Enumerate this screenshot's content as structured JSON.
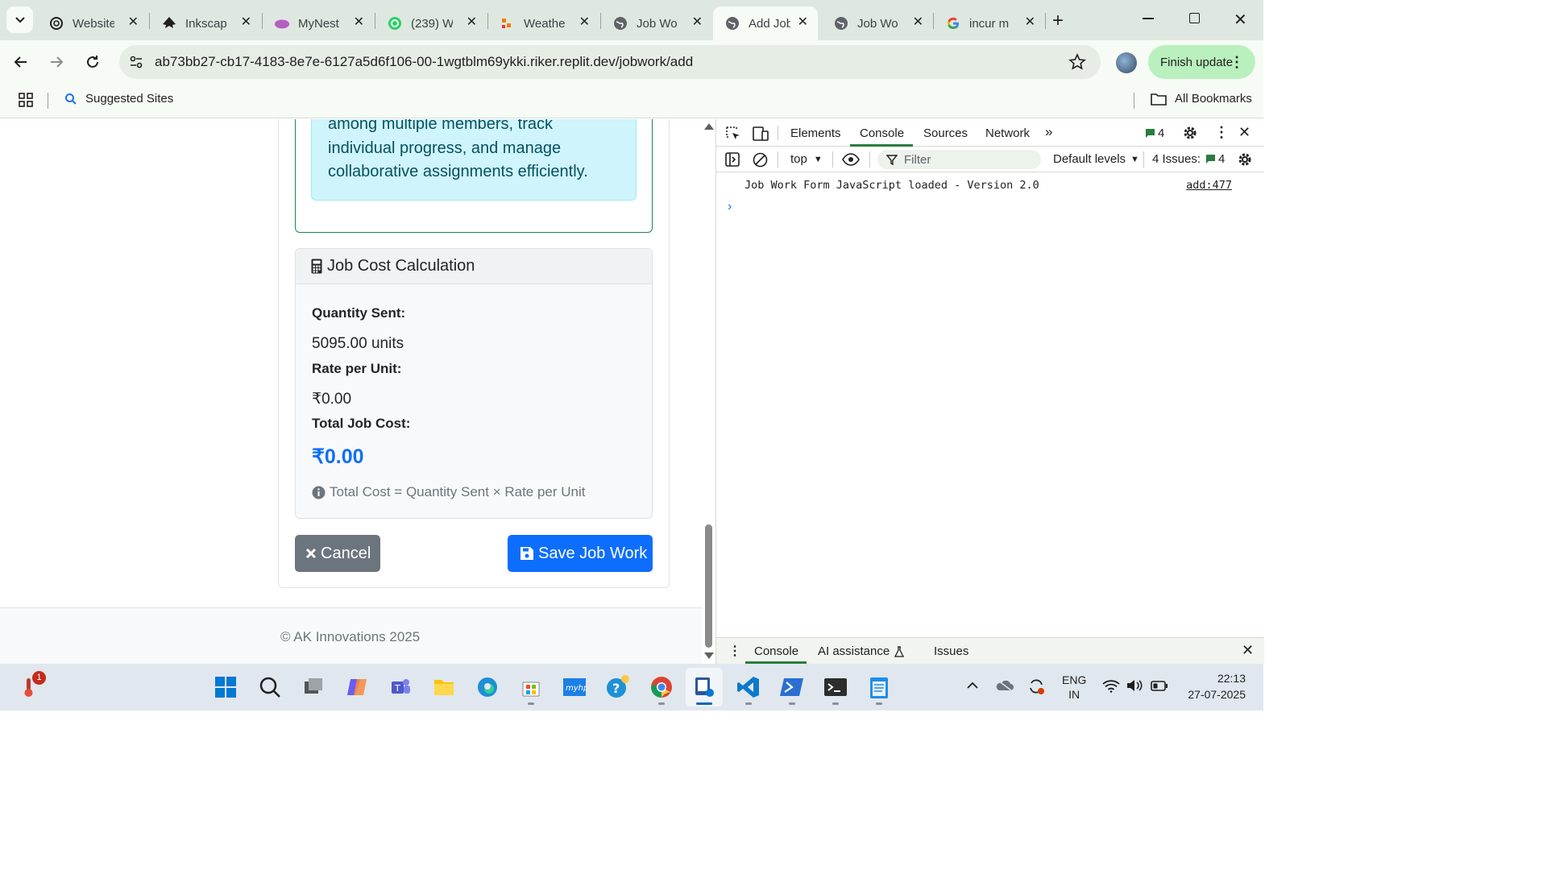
{
  "browser": {
    "tabs": [
      {
        "title": "Website",
        "icon": "openai-icon"
      },
      {
        "title": "Inkscape",
        "icon": "inkscape-icon"
      },
      {
        "title": "MyNest",
        "icon": "cloud-icon"
      },
      {
        "title": "(239) W",
        "icon": "whatsapp-icon"
      },
      {
        "title": "Weather",
        "icon": "weather-icon"
      },
      {
        "title": "Job Wo",
        "icon": "globe-icon"
      },
      {
        "title": "Add Job",
        "icon": "globe-icon",
        "active": true
      },
      {
        "title": "Job Wo",
        "icon": "globe-icon"
      },
      {
        "title": "incur m",
        "icon": "google-icon"
      }
    ],
    "url": "ab73bb27-cb17-4183-8e7e-6127a5d6f106-00-1wgtblm69ykki.riker.replit.dev/jobwork/add",
    "finish_update_label": "Finish update",
    "bookmarks": {
      "suggested": "Suggested Sites",
      "all": "All Bookmarks"
    }
  },
  "page": {
    "alert_lines": [
      "among multiple members, track",
      "individual progress, and manage",
      "collaborative assignments efficiently."
    ],
    "cost": {
      "title": "Job Cost Calculation",
      "quantity_label": "Quantity Sent:",
      "quantity_value": "5095.00 units",
      "rate_label": "Rate per Unit:",
      "rate_value": "₹0.00",
      "total_label": "Total Job Cost:",
      "total_value": "₹0.00",
      "formula": "Total Cost = Quantity Sent × Rate per Unit"
    },
    "cancel_label": "Cancel",
    "save_label": "Save Job Work",
    "footer": "© AK Innovations 2025"
  },
  "devtools": {
    "tabs": [
      "Elements",
      "Console",
      "Sources",
      "Network"
    ],
    "active_tab": "Console",
    "message_count": "4",
    "context": "top",
    "filter_placeholder": "Filter",
    "levels": "Default levels",
    "issues_label": "4 Issues:",
    "issues_count": "4",
    "console_message": "Job Work Form JavaScript loaded - Version 2.0",
    "message_source": "add:477",
    "drawer_tabs": [
      "Console",
      "AI assistance",
      "Issues"
    ]
  },
  "taskbar": {
    "notification_badge": "1",
    "language": [
      "ENG",
      "IN"
    ],
    "time": "22:13",
    "date": "27-07-2025"
  }
}
